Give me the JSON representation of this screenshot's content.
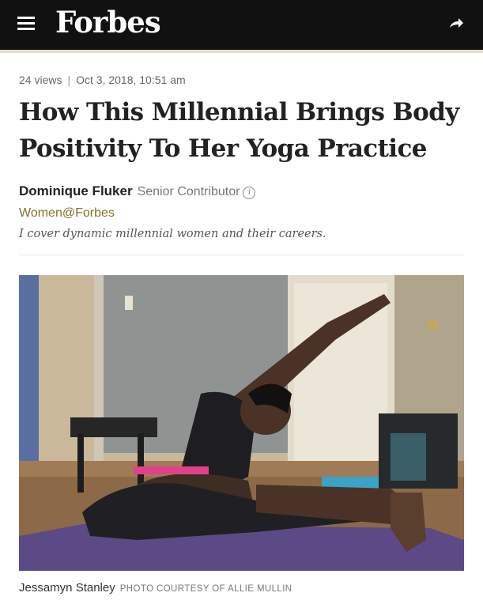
{
  "header": {
    "brand": "Forbes",
    "menu_icon": "hamburger-menu-icon",
    "share_icon": "share-arrow-icon",
    "background": "#111111"
  },
  "article": {
    "views": "24 views",
    "separator": "|",
    "date": "Oct 3, 2018, 10:51 am",
    "headline": "How This Millennial Brings Body Positivity To Her Yoga Practice",
    "author": {
      "name": "Dominique Fluker",
      "role": "Senior Contributor",
      "info_icon": "i",
      "channel": "Women@Forbes",
      "bio": "I cover dynamic millennial women and their careers."
    },
    "image": {
      "caption": "Jessamyn Stanley",
      "credit": "PHOTO COURTESY OF ALLIE MULLIN"
    }
  }
}
